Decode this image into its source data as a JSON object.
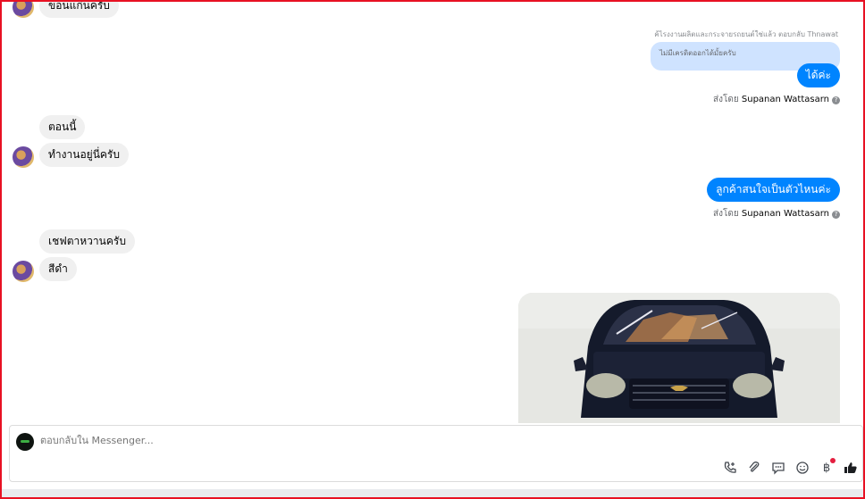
{
  "messages": {
    "m1": "ขอนแก่นครับ",
    "reply_ref": "ค้ไรงงานผลิตและกระจายรถยนต์ใช่แล้ว ตอบกลับ Thnawat",
    "quoted": "ไม่มีเครดิตออกได้มั้ยครับ",
    "m2": "ได้ค่ะ",
    "sent_by_prefix": "ส่งโดย",
    "sent_by_name": "Supanan Wattasarn",
    "m3": "ตอนนี้",
    "m4": "ทำงานอยู่นี่ครับ",
    "m5": "ลูกค้าสนใจเป็นตัวไหนค่ะ",
    "m6": "เชฟตาหวานครับ",
    "m7": "สีดำ"
  },
  "composer": {
    "placeholder": "ตอบกลับใน Messenger..."
  },
  "icons": {
    "help": "?",
    "baht": "฿",
    "tools": [
      "phone-add-icon",
      "attach-icon",
      "saved-reply-icon",
      "emoji-icon",
      "payment-icon",
      "like-icon"
    ]
  },
  "colors": {
    "outgoing": "#0084ff",
    "incoming": "#f0f0f0",
    "quoted": "#cfe3ff",
    "frame": "#e81123"
  }
}
